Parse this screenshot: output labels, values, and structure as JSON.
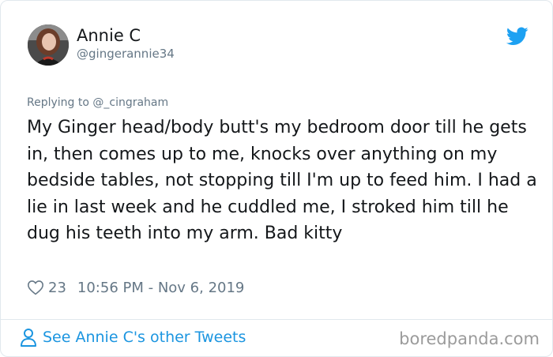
{
  "author": {
    "display_name": "Annie C",
    "handle": "@gingerannie34"
  },
  "reply_context": "Replying to @_cingraham",
  "tweet_text": "My Ginger head/body butt's my bedroom door till he gets in, then comes up to me, knocks over anything on my bedside tables, not stopping till I'm up to feed him. I had a lie in last week and he cuddled me, I stroked him till he dug his teeth into my arm. Bad kitty",
  "like_count": "23",
  "timestamp": "10:56 PM - Nov 6, 2019",
  "footer": {
    "see_more_label": "See Annie C's other Tweets"
  },
  "watermark": "boredpanda.com",
  "icons": {
    "brand": "twitter-bird-icon",
    "like": "heart-icon",
    "profile": "person-icon"
  },
  "colors": {
    "twitter_blue": "#1da1f2",
    "link_blue": "#1b95e0",
    "secondary_text": "#657786",
    "primary_text": "#14171a"
  }
}
